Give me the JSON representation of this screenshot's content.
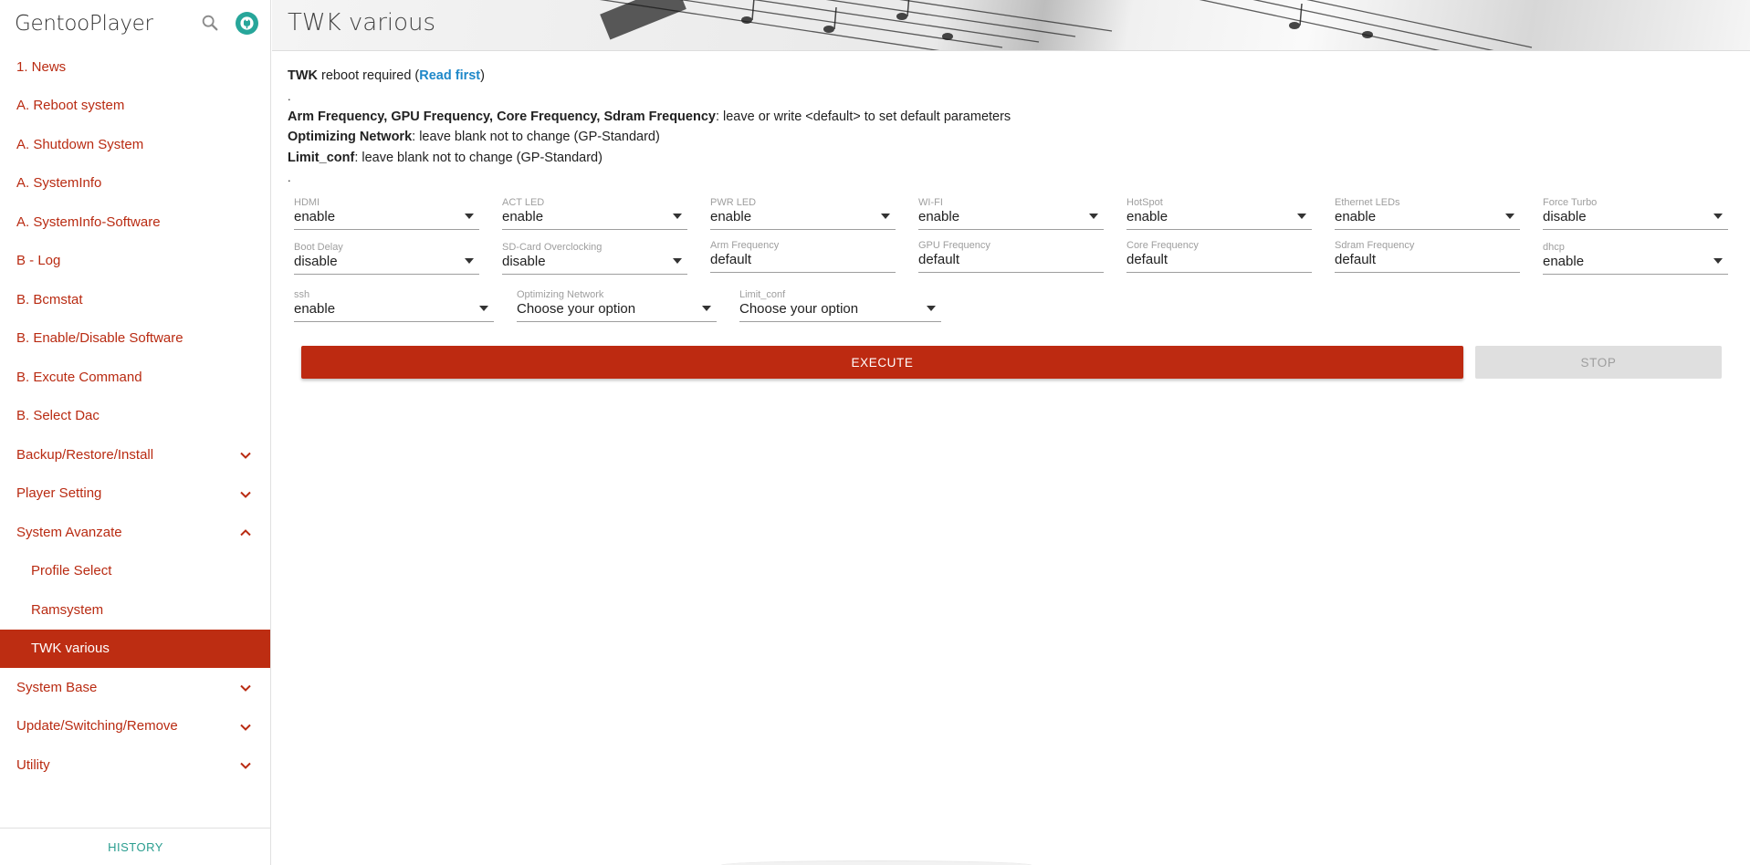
{
  "app": {
    "title": "GentooPlayer",
    "search_icon": "search-icon",
    "github_icon": "github-icon"
  },
  "sidebar": {
    "items": [
      {
        "label": "1. News",
        "expandable": false
      },
      {
        "label": "A. Reboot system",
        "expandable": false
      },
      {
        "label": "A. Shutdown System",
        "expandable": false
      },
      {
        "label": "A. SystemInfo",
        "expandable": false
      },
      {
        "label": "A. SystemInfo-Software",
        "expandable": false
      },
      {
        "label": "B - Log",
        "expandable": false
      },
      {
        "label": "B. Bcmstat",
        "expandable": false
      },
      {
        "label": "B. Enable/Disable Software",
        "expandable": false
      },
      {
        "label": "B. Excute Command",
        "expandable": false
      },
      {
        "label": "B. Select Dac",
        "expandable": false
      },
      {
        "label": "Backup/Restore/Install",
        "expandable": true,
        "state": "collapsed"
      },
      {
        "label": "Player Setting",
        "expandable": true,
        "state": "collapsed"
      },
      {
        "label": "System Avanzate",
        "expandable": true,
        "state": "expanded"
      },
      {
        "label": "Profile Select",
        "sub": true
      },
      {
        "label": "Ramsystem",
        "sub": true
      },
      {
        "label": "TWK various",
        "sub": true,
        "active": true
      },
      {
        "label": "System Base",
        "expandable": true,
        "state": "collapsed"
      },
      {
        "label": "Update/Switching/Remove",
        "expandable": true,
        "state": "collapsed"
      },
      {
        "label": "Utility",
        "expandable": true,
        "state": "collapsed"
      }
    ],
    "history_label": "HISTORY"
  },
  "header": {
    "title": "TWK various"
  },
  "notes": {
    "line1_bold": "TWK",
    "line1_text": " reboot required (",
    "line1_link": "Read first",
    "line1_end": ")",
    "dot": ".",
    "line2_bold": "Arm Frequency, GPU Frequency, Core Frequency, Sdram Frequency",
    "line2_text": ": leave or write <default> to set default parameters",
    "line3_bold": "Optimizing Network",
    "line3_text": ": leave blank not to change (GP-Standard)",
    "line4_bold": "Limit_conf",
    "line4_text": ": leave blank not to change (GP-Standard)"
  },
  "fields": {
    "hdmi": {
      "label": "HDMI",
      "value": "enable"
    },
    "act_led": {
      "label": "ACT LED",
      "value": "enable"
    },
    "pwr_led": {
      "label": "PWR LED",
      "value": "enable"
    },
    "wifi": {
      "label": "WI-FI",
      "value": "enable"
    },
    "hotspot": {
      "label": "HotSpot",
      "value": "enable"
    },
    "ethernet_leds": {
      "label": "Ethernet LEDs",
      "value": "enable"
    },
    "force_turbo": {
      "label": "Force Turbo",
      "value": "disable"
    },
    "boot_delay": {
      "label": "Boot Delay",
      "value": "disable"
    },
    "sd_overclock": {
      "label": "SD-Card Overclocking",
      "value": "disable"
    },
    "arm_freq": {
      "label": "Arm Frequency",
      "value": "default"
    },
    "gpu_freq": {
      "label": "GPU Frequency",
      "value": "default"
    },
    "core_freq": {
      "label": "Core Frequency",
      "value": "default"
    },
    "sdram_freq": {
      "label": "Sdram Frequency",
      "value": "default"
    },
    "dhcp": {
      "label": "dhcp",
      "value": "enable"
    },
    "ssh": {
      "label": "ssh",
      "value": "enable"
    },
    "opt_network": {
      "label": "Optimizing Network",
      "value": "Choose your option"
    },
    "limit_conf": {
      "label": "Limit_conf",
      "value": "Choose your option"
    }
  },
  "actions": {
    "execute": "EXECUTE",
    "stop": "STOP"
  },
  "colors": {
    "accent": "#bd2d12",
    "link": "#1e88c9",
    "history": "#2a9d8f"
  }
}
